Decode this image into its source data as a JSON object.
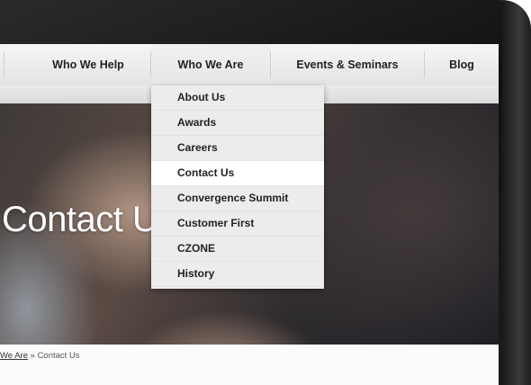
{
  "nav": {
    "items": [
      {
        "label": "Who We Help"
      },
      {
        "label": "Who We Are"
      },
      {
        "label": "Events & Seminars"
      },
      {
        "label": "Blog"
      }
    ]
  },
  "dropdown": {
    "items": [
      {
        "label": "About Us"
      },
      {
        "label": "Awards"
      },
      {
        "label": "Careers"
      },
      {
        "label": "Contact Us"
      },
      {
        "label": "Convergence Summit"
      },
      {
        "label": "Customer First"
      },
      {
        "label": "CZONE"
      },
      {
        "label": "History"
      }
    ],
    "active_item": "Contact Us"
  },
  "hero": {
    "title": "Contact U"
  },
  "breadcrumb": {
    "parent": "We Are",
    "separator": "»",
    "current": "Contact Us"
  }
}
